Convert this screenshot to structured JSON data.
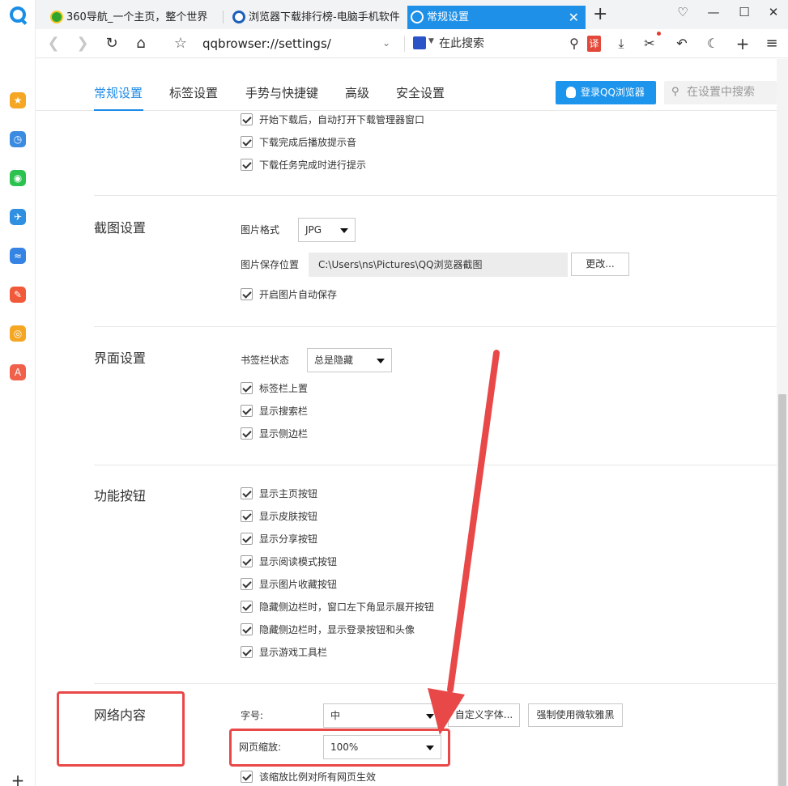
{
  "browser": {
    "tabs": [
      {
        "title": "360导航_一个主页，整个世界",
        "favicon_color": "#2fa52f"
      },
      {
        "title": "浏览器下载排行榜-电脑手机软件",
        "favicon_color": "#1d5fb8"
      },
      {
        "title": "常规设置",
        "favicon_color": "#ffffff",
        "active": true
      }
    ],
    "url": "qqbrowser://settings/",
    "search_placeholder": "在此搜索",
    "translate_badge": "译"
  },
  "sidebar_apps": [
    {
      "icon": "star-icon",
      "color": "#f5a623",
      "glyph": "★"
    },
    {
      "icon": "clock-icon",
      "color": "#3b8be0",
      "glyph": "◷"
    },
    {
      "icon": "wechat-icon",
      "color": "#2cc24f",
      "glyph": "◉"
    },
    {
      "icon": "pin-icon",
      "color": "#2f8fe0",
      "glyph": "✈"
    },
    {
      "icon": "cloud-icon",
      "color": "#3584e4",
      "glyph": "≈"
    },
    {
      "icon": "pdf-icon",
      "color": "#f05a3a",
      "glyph": "✎"
    },
    {
      "icon": "search-app-icon",
      "color": "#f5a623",
      "glyph": "◎"
    },
    {
      "icon": "translate-app-icon",
      "color": "#f0604a",
      "glyph": "A"
    }
  ],
  "settings": {
    "tabs": [
      "常规设置",
      "标签设置",
      "手势与快捷键",
      "高级",
      "安全设置"
    ],
    "login_label": "登录QQ浏览器",
    "search_placeholder": "在设置中搜索",
    "download": {
      "options": [
        "开始下载后，自动打开下载管理器窗口",
        "下载完成后播放提示音",
        "下载任务完成时进行提示"
      ]
    },
    "screenshot": {
      "title": "截图设置",
      "format_label": "图片格式",
      "format_value": "JPG",
      "save_label": "图片保存位置",
      "save_path": "C:\\Users\\ns\\Pictures\\QQ浏览器截图",
      "change_label": "更改...",
      "auto_save": "开启图片自动保存"
    },
    "interface": {
      "title": "界面设置",
      "bookmark_label": "书签栏状态",
      "bookmark_value": "总是隐藏",
      "options": [
        "标签栏上置",
        "显示搜索栏",
        "显示侧边栏"
      ]
    },
    "buttons": {
      "title": "功能按钮",
      "options": [
        "显示主页按钮",
        "显示皮肤按钮",
        "显示分享按钮",
        "显示阅读模式按钮",
        "显示图片收藏按钮",
        "隐藏侧边栏时，窗口左下角显示展开按钮",
        "隐藏侧边栏时，显示登录按钮和头像",
        "显示游戏工具栏"
      ]
    },
    "web": {
      "title": "网络内容",
      "font_label": "字号:",
      "font_value": "中",
      "custom_font_label": "自定义字体...",
      "force_yahei_label": "强制使用微软雅黑",
      "zoom_label": "网页缩放:",
      "zoom_value": "100%",
      "zoom_all": "该缩放比例对所有网页生效"
    }
  },
  "annotation_color": "#e84848"
}
